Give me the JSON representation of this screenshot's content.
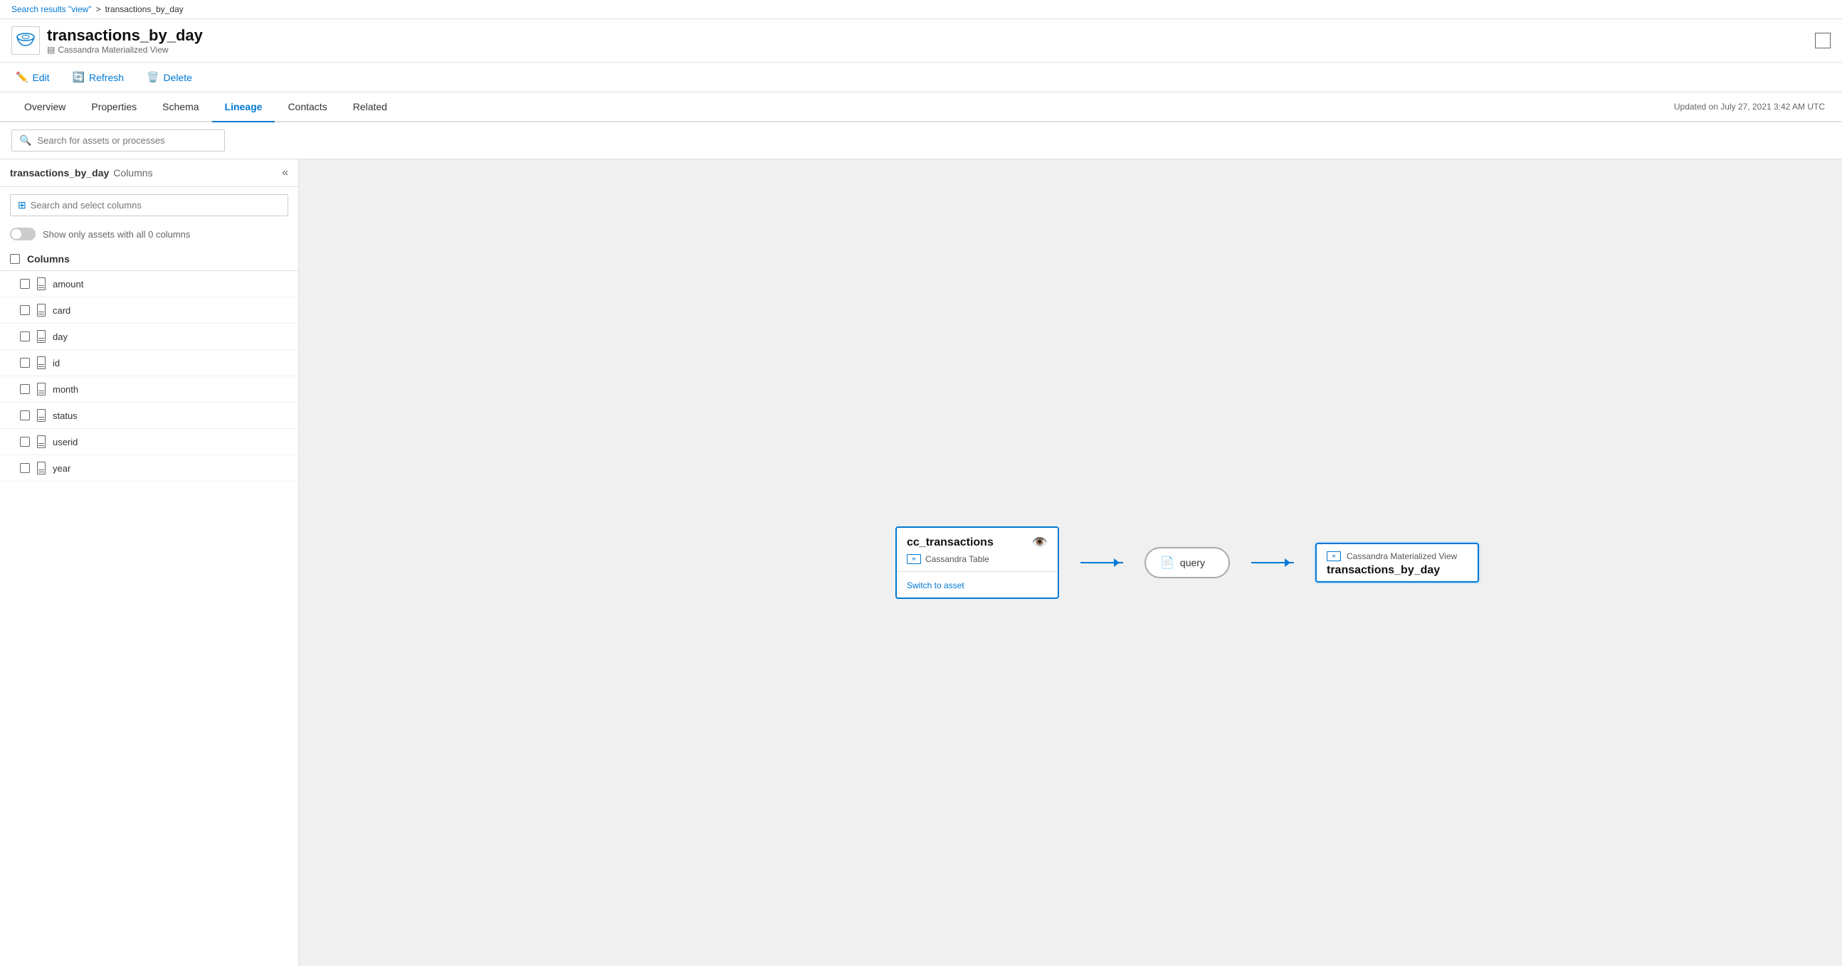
{
  "breadcrumb": {
    "link_text": "Search results \"view\"",
    "separator": ">",
    "current": "transactions_by_day"
  },
  "header": {
    "title": "transactions_by_day",
    "subtitle": "Cassandra Materialized View",
    "logo_label": "cassandra"
  },
  "toolbar": {
    "edit_label": "Edit",
    "refresh_label": "Refresh",
    "delete_label": "Delete"
  },
  "tabs": {
    "items": [
      {
        "id": "overview",
        "label": "Overview"
      },
      {
        "id": "properties",
        "label": "Properties"
      },
      {
        "id": "schema",
        "label": "Schema"
      },
      {
        "id": "lineage",
        "label": "Lineage"
      },
      {
        "id": "contacts",
        "label": "Contacts"
      },
      {
        "id": "related",
        "label": "Related"
      }
    ],
    "active": "lineage",
    "updated_text": "Updated on July 27, 2021 3:42 AM UTC"
  },
  "search_bar": {
    "placeholder": "Search for assets or processes"
  },
  "left_panel": {
    "title_main": "transactions_by_day",
    "title_sub": "Columns",
    "column_search_placeholder": "Search and select columns",
    "toggle_label": "Show only assets with all 0 columns",
    "columns_header": "Columns",
    "columns": [
      {
        "name": "amount"
      },
      {
        "name": "card"
      },
      {
        "name": "day"
      },
      {
        "name": "id"
      },
      {
        "name": "month"
      },
      {
        "name": "status"
      },
      {
        "name": "userid"
      },
      {
        "name": "year"
      }
    ]
  },
  "lineage": {
    "source_node": {
      "title": "cc_transactions",
      "subtitle": "Cassandra Table",
      "switch_link": "Switch to asset"
    },
    "process_node": {
      "label": "query"
    },
    "target_node": {
      "supertitle": "Cassandra Materialized View",
      "title": "transactions_by_day"
    }
  }
}
